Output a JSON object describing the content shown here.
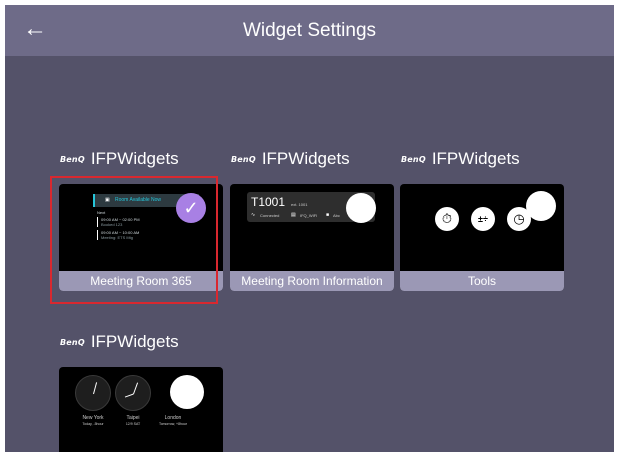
{
  "header": {
    "title": "Widget Settings",
    "back_icon": "arrow-left-icon"
  },
  "widgets": [
    {
      "brand": "BenQ",
      "provider": "IFPWidgets",
      "label": "Meeting Room 365",
      "selected": true
    },
    {
      "brand": "BenQ",
      "provider": "IFPWidgets",
      "label": "Meeting Room Information",
      "selected": false
    },
    {
      "brand": "BenQ",
      "provider": "IFPWidgets",
      "label": "Tools",
      "selected": false
    },
    {
      "brand": "BenQ",
      "provider": "IFPWidgets",
      "label": "",
      "selected": false
    }
  ],
  "preview_mr365": {
    "status": "Room Available Now",
    "next": "Next",
    "slots": [
      {
        "time": "09:00 AM ~ 02:00 PM",
        "desc": "Booked 123"
      },
      {
        "time": "09:00 AM ~ 10:00 AM",
        "desc": "Meeting: ETS Mtg"
      }
    ]
  },
  "preview_mri": {
    "room": "T1001",
    "ext": "ext. 1001",
    "connected": "Connected",
    "wifi": "IFQ_WIFI",
    "lock": "Abc"
  },
  "preview_tools": {
    "icons": [
      "stopwatch-icon",
      "calculator-icon",
      "timer-icon"
    ]
  },
  "preview_clock": {
    "cities": [
      {
        "name": "New York",
        "sub": "Today, -5hour"
      },
      {
        "name": "Taipei",
        "sub": "12/9 SAT"
      },
      {
        "name": "London",
        "sub": "Tomorrow, +8hour"
      }
    ]
  },
  "colors": {
    "background": "#545269",
    "header": "#6e6b88",
    "label": "#9b98b5",
    "selection": "#d9282f",
    "check": "#a880e4",
    "accent": "#26c6da"
  }
}
